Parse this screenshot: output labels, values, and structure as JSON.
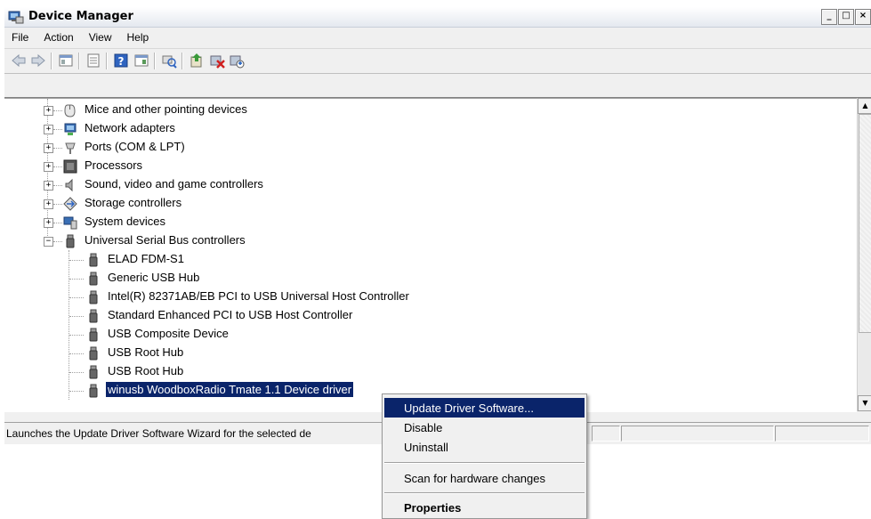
{
  "window": {
    "title": "Device Manager",
    "controls": [
      "_",
      "□",
      "×"
    ]
  },
  "menu": [
    "File",
    "Action",
    "View",
    "Help"
  ],
  "toolbar": {
    "buttons": [
      "back-icon",
      "forward-icon",
      "show-hide-console-tree-icon",
      "properties-icon",
      "help-icon",
      "action-pane-icon",
      "scan-hardware-icon",
      "update-driver-icon",
      "uninstall-icon",
      "disable-icon"
    ]
  },
  "tree": {
    "categories": [
      {
        "label": "Mice and other pointing devices",
        "icon": "mouse-icon",
        "expander": "+"
      },
      {
        "label": "Network adapters",
        "icon": "network-icon",
        "expander": "+"
      },
      {
        "label": "Ports (COM & LPT)",
        "icon": "port-icon",
        "expander": "+"
      },
      {
        "label": "Processors",
        "icon": "processor-icon",
        "expander": "+"
      },
      {
        "label": "Sound, video and game controllers",
        "icon": "speaker-icon",
        "expander": "+"
      },
      {
        "label": "Storage controllers",
        "icon": "storage-icon",
        "expander": "+"
      },
      {
        "label": "System devices",
        "icon": "computer-icon",
        "expander": "+"
      },
      {
        "label": "Universal Serial Bus controllers",
        "icon": "usb-icon",
        "expander": "−"
      }
    ],
    "usb_children": [
      "ELAD FDM-S1",
      "Generic USB Hub",
      "Intel(R) 82371AB/EB PCI to USB Universal Host Controller",
      "Standard Enhanced PCI to USB Host Controller",
      "USB Composite Device",
      "USB Root Hub",
      "USB Root Hub",
      "winusb WoodboxRadio Tmate 1.1 Device driver"
    ],
    "selected_index": 7
  },
  "statusbar": {
    "text": "Launches the Update Driver Software Wizard for the selected de"
  },
  "context_menu": {
    "items": [
      "Update Driver Software...",
      "Disable",
      "Uninstall",
      "Scan for hardware changes",
      "Properties"
    ],
    "highlighted": 0
  },
  "colors": {
    "selection": "#0a246a",
    "window_bg": "#f0f0f0"
  }
}
